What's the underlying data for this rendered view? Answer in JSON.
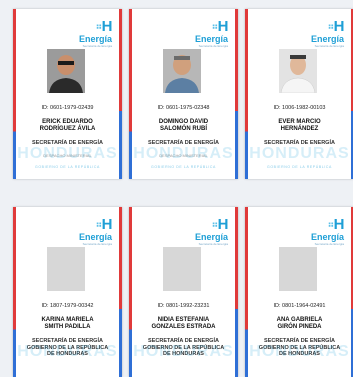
{
  "logo": {
    "mark": "H",
    "word": "Energía",
    "sub": "Secretaría de Energía"
  },
  "watermark": "HONDURAS",
  "watermark_sub": "GOBIERNO DE LA REPÚBLICA",
  "cards": [
    {
      "id": "ID: 0601-1979-02439",
      "name1": "ERICK EDUARDO",
      "name2": "RODRÍGUEZ ÁVILA",
      "dept1": "SECRETARÍA DE ENERGÍA",
      "dept2": "",
      "sub": "DESPACHO MINISTERIAL"
    },
    {
      "id": "ID: 0601-1975-02348",
      "name1": "DOMINGO DAVID",
      "name2": "SALOMÓN RUBÍ",
      "dept1": "SECRETARÍA DE ENERGÍA",
      "dept2": "",
      "sub": "DESPACHO MINISTERIAL"
    },
    {
      "id": "ID: 1006-1982-00103",
      "name1": "EVER MARCIO",
      "name2": "HERNÁNDEZ",
      "dept1": "SECRETARÍA DE ENERGÍA",
      "dept2": "",
      "sub": ""
    },
    {
      "id": "ID: 1807-1979-00342",
      "name1": "KARINA MARIELA",
      "name2": "SMITH PADILLA",
      "dept1": "SECRETARÍA DE ENERGÍA",
      "dept2": "GOBIERNO DE LA REPÚBLICA",
      "sub": "DE HONDURAS"
    },
    {
      "id": "ID: 0801-1992-23231",
      "name1": "NIDIA ESTEFANIA",
      "name2": "GONZALES ESTRADA",
      "dept1": "SECRETARÍA DE ENERGÍA",
      "dept2": "GOBIERNO DE LA REPÚBLICA",
      "sub": "DE HONDURAS"
    },
    {
      "id": "ID: 0801-1964-02491",
      "name1": "ANA GABRIELA",
      "name2": "GIRÓN PINEDA",
      "dept1": "SECRETARÍA DE ENERGÍA",
      "dept2": "GOBIERNO DE LA REPÚBLICA",
      "sub": "DE HONDURAS"
    }
  ]
}
